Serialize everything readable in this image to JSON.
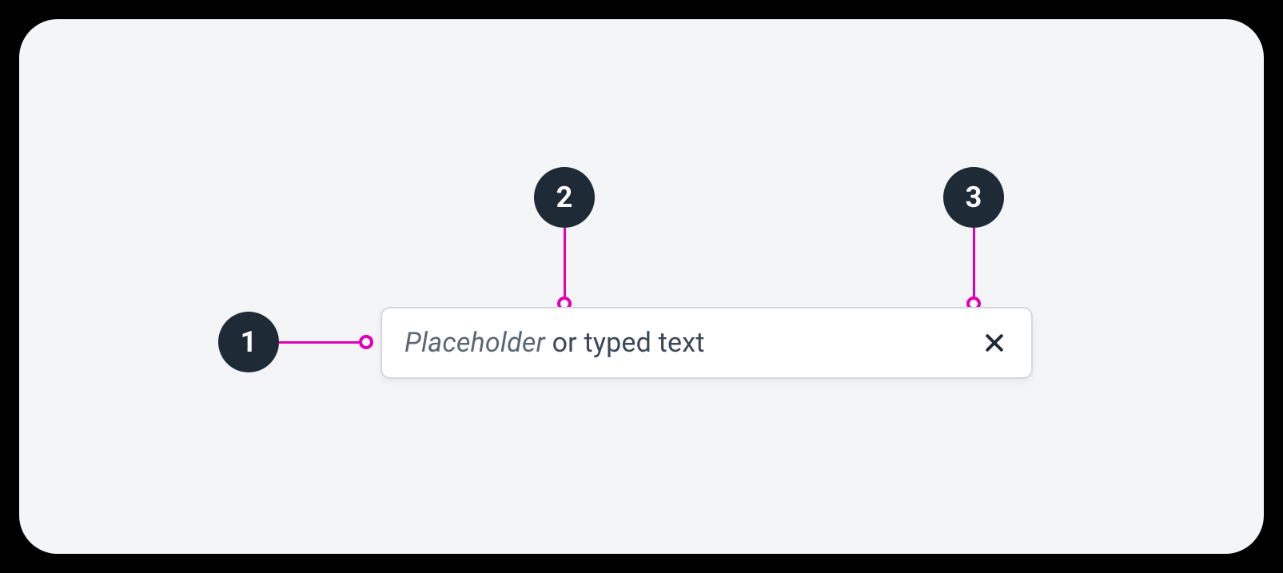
{
  "callouts": [
    {
      "num": "1"
    },
    {
      "num": "2"
    },
    {
      "num": "3"
    }
  ],
  "input": {
    "placeholder_word": "Placeholder",
    "rest": " or typed text"
  },
  "colors": {
    "accent": "#e100b8",
    "badge_bg": "#1f2a37",
    "panel_bg": "#f4f5f7"
  }
}
